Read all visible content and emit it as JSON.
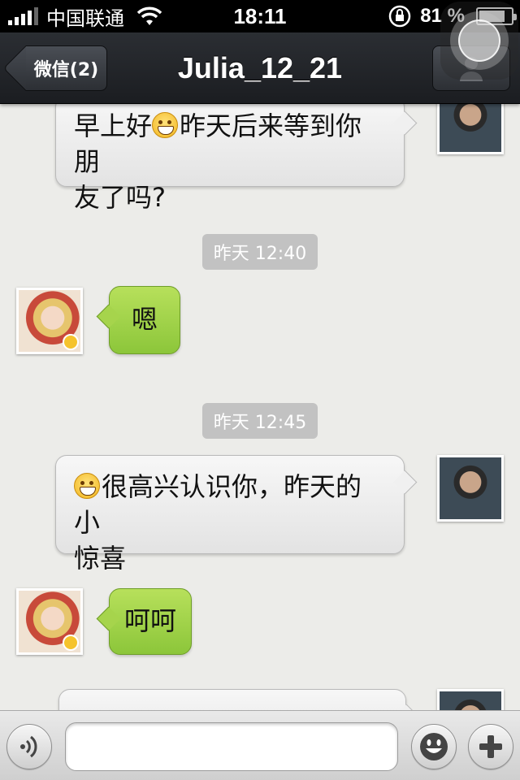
{
  "status_bar": {
    "carrier": "中国联通",
    "time": "18:11",
    "battery_percent": "81 %",
    "battery_level": 0.81
  },
  "nav": {
    "back_label": "微信(2)",
    "title": "Julia_12_21"
  },
  "messages": [
    {
      "sender": "me",
      "emoji_prefix": false,
      "text_before": "早上好",
      "has_emoji": true,
      "text_after": "昨天后来等到你朋友了吗?"
    },
    {
      "type": "timestamp",
      "text": "昨天 12:40"
    },
    {
      "sender": "Julia_12_21",
      "text": "嗯"
    },
    {
      "type": "timestamp",
      "text": "昨天 12:45"
    },
    {
      "sender": "me",
      "has_emoji": true,
      "text": "很高兴认识你，昨天的小惊喜"
    },
    {
      "sender": "Julia_12_21",
      "text": "呵呵"
    }
  ],
  "chat": {
    "m1_before": "早上好",
    "m1_after_line1": "昨天后来等到你朋",
    "m1_after_line2": "友了吗?",
    "ts1": "昨天 12:40",
    "m2": "嗯",
    "ts2": "昨天 12:45",
    "m3_line1": "很高兴认识你，昨天的小",
    "m3_line2": "惊喜",
    "m4": "呵呵"
  },
  "input": {
    "value": "",
    "placeholder": ""
  },
  "icons": {
    "voice": "voice-icon",
    "emoji": "smiley-icon",
    "plus": "plus-icon",
    "profile": "person-icon",
    "wifi": "wifi-icon",
    "rotation_lock": "rotation-lock-icon"
  },
  "colors": {
    "incoming_bubble": "#9ccd44",
    "outgoing_bubble": "#eeeeee",
    "nav_bar": "#23262a"
  }
}
